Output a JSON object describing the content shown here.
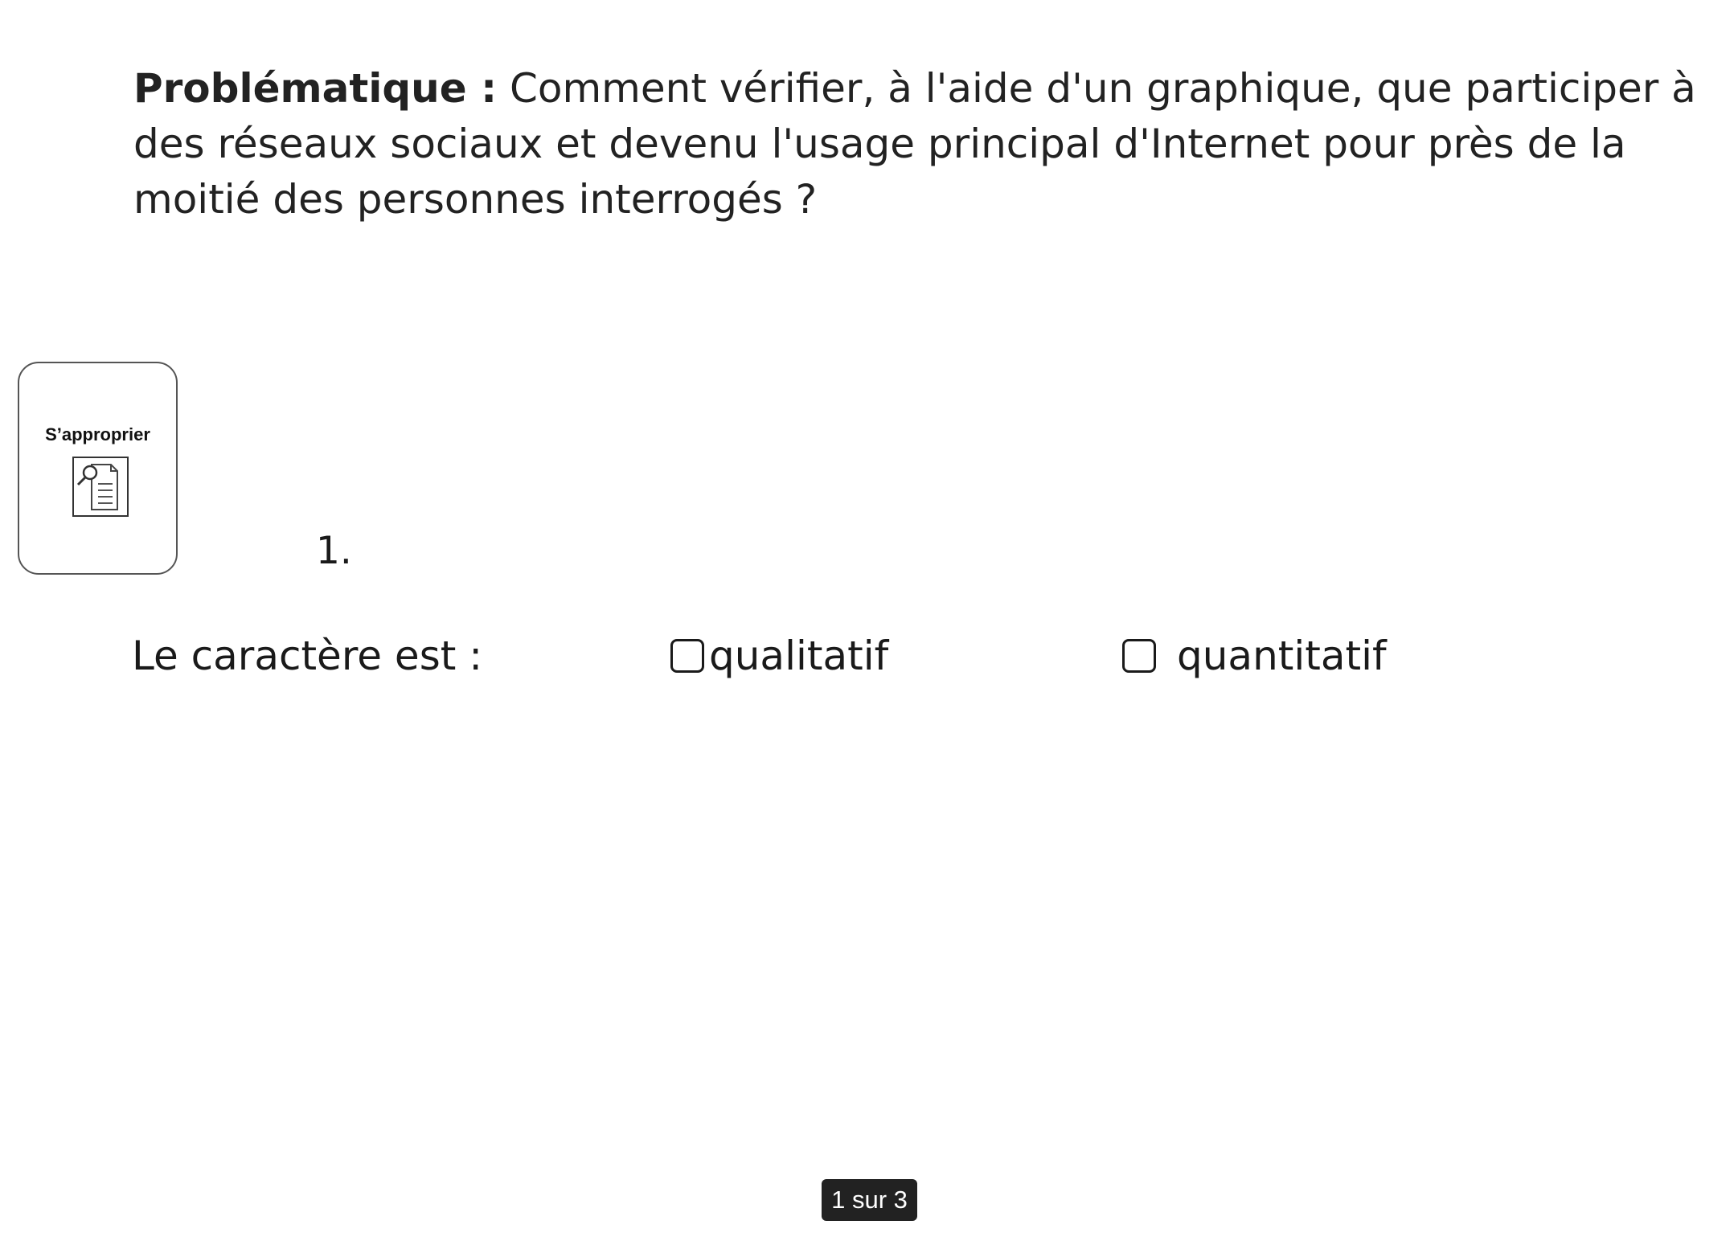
{
  "problem": {
    "lead": "Problématique :",
    "text": " Comment vérifier, à l'aide d'un graphique, que participer à des réseaux sociaux et devenu l'usage principal d'Internet pour près de la moitié des personnes interrogés ?"
  },
  "skill_card": {
    "label": "S’approprier",
    "icon": "document-search-icon"
  },
  "question": {
    "number": "1.",
    "prompt": "Le caractère est :",
    "options": [
      {
        "label": "qualitatif",
        "checked": false
      },
      {
        "label": "quantitatif",
        "checked": false
      }
    ]
  },
  "pager": {
    "text": "1 sur 3"
  }
}
